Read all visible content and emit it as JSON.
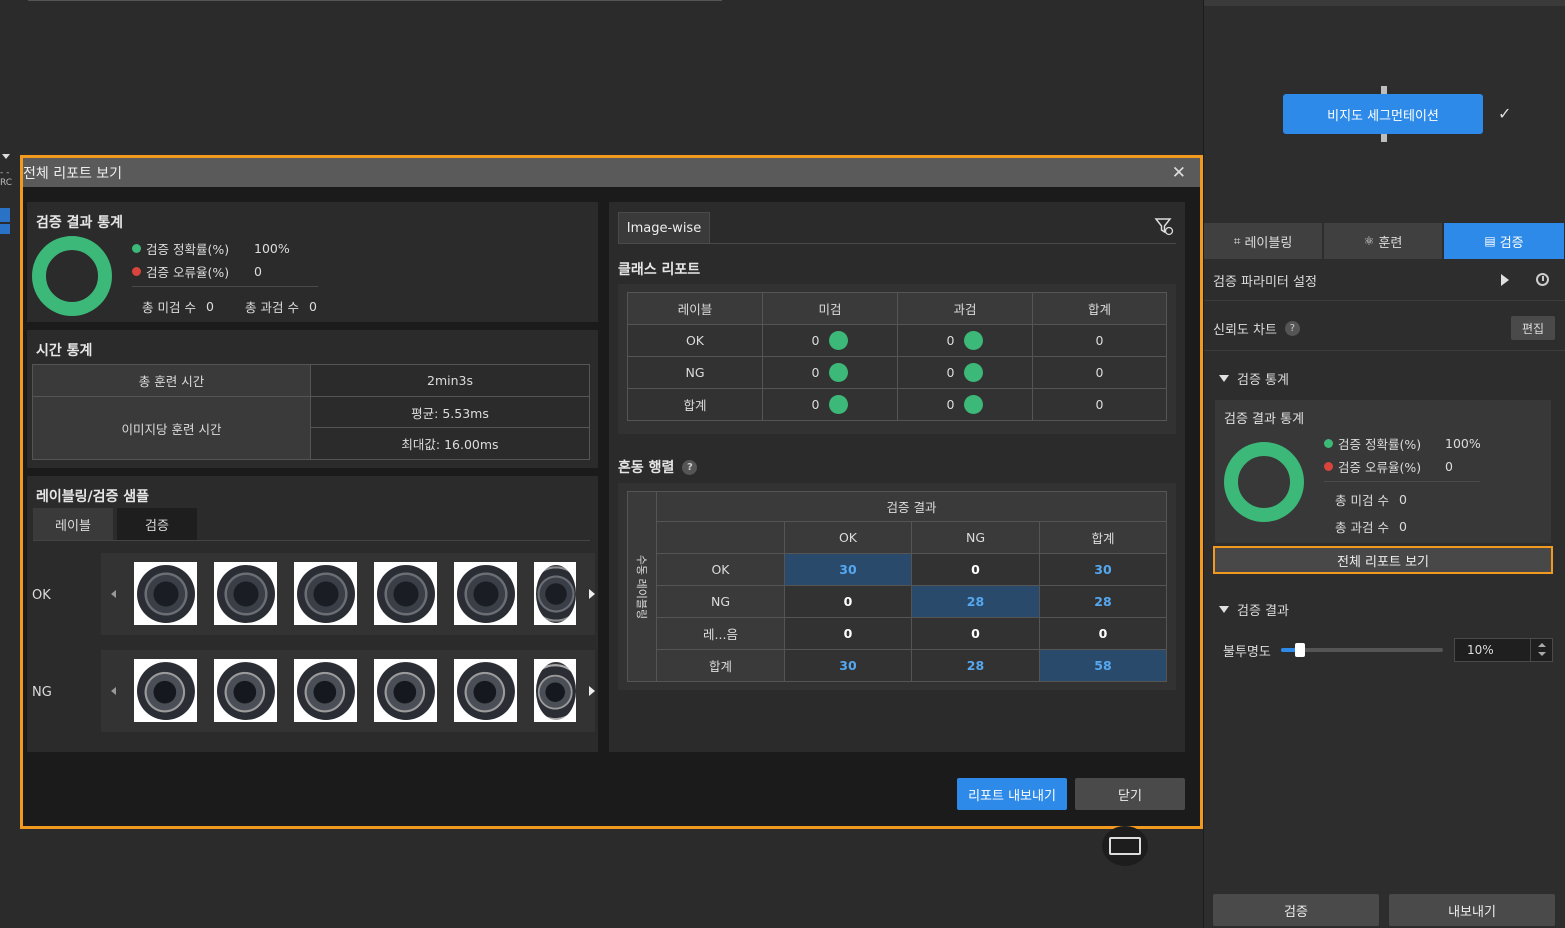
{
  "left_strip": {
    "dash": "- -",
    "rc": "RC"
  },
  "node": {
    "label": "비지도 세그먼테이션",
    "check": "✓"
  },
  "side_tabs": [
    {
      "label": "레이블링",
      "icon": "crop-icon"
    },
    {
      "label": "훈련",
      "icon": "network-icon"
    },
    {
      "label": "검증",
      "icon": "report-icon"
    }
  ],
  "side": {
    "param_label": "검증 파라미터 설정",
    "confidence_label": "신뢰도 차트",
    "edit_label": "편집",
    "stats_section": "검증 통계",
    "stats_card_title": "검증 결과 통계",
    "accuracy_label": "검증 정확률(%)",
    "accuracy_value": "100%",
    "error_label": "검증 오류율(%)",
    "error_value": "0",
    "miss_label": "총 미검 수",
    "miss_value": "0",
    "over_label": "총 과검 수",
    "over_value": "0",
    "report_button": "전체 리포트 보기",
    "result_section": "검증 결과",
    "opacity_label": "불투명도",
    "opacity_value": "10%",
    "opacity_fraction": 0.1,
    "validate_button": "검증",
    "export_button": "내보내기"
  },
  "dialog": {
    "title": "전체 리포트 보기",
    "close": "✕",
    "stats": {
      "title": "검증 결과 통계",
      "accuracy_label": "검증 정확률(%)",
      "accuracy_value": "100%",
      "error_label": "검증 오류율(%)",
      "error_value": "0",
      "miss_label": "총 미검 수",
      "miss_value": "0",
      "over_label": "총 과검 수",
      "over_value": "0"
    },
    "time": {
      "title": "시간 통계",
      "total_label": "총 훈련 시간",
      "total_value": "2min3s",
      "per_image_label": "이미지당 훈련 시간",
      "avg": "평균: 5.53ms",
      "max": "최대값: 16.00ms"
    },
    "samples": {
      "title": "레이블링/검증 샘플",
      "tab_label": "레이블",
      "tab_validate": "검증",
      "row_ok": "OK",
      "row_ng": "NG"
    },
    "image_wise_tab": "Image-wise",
    "class_report": {
      "title": "클래스 리포트",
      "headers": [
        "레이블",
        "미검",
        "과검",
        "합계"
      ],
      "rows": [
        {
          "label": "OK",
          "miss": "0",
          "over": "0",
          "total": "0"
        },
        {
          "label": "NG",
          "miss": "0",
          "over": "0",
          "total": "0"
        },
        {
          "label": "합계",
          "miss": "0",
          "over": "0",
          "total": "0"
        }
      ]
    },
    "confusion": {
      "title": "혼동 행렬",
      "top_header": "검증 결과",
      "side_header": "수동 레이블링",
      "cols": [
        "OK",
        "NG",
        "합계"
      ],
      "rows": [
        {
          "label": "OK",
          "values": [
            "30",
            "0",
            "30"
          ]
        },
        {
          "label": "NG",
          "values": [
            "0",
            "28",
            "28"
          ]
        },
        {
          "label": "레...음",
          "values": [
            "0",
            "0",
            "0"
          ]
        },
        {
          "label": "합계",
          "values": [
            "30",
            "28",
            "58"
          ]
        }
      ]
    },
    "export_button": "리포트 내보내기",
    "close_button": "닫기"
  },
  "colors": {
    "accent": "#2d8ae8",
    "ok_green": "#3cb878",
    "error_red": "#d9453d",
    "highlight": "#f29a1f"
  }
}
